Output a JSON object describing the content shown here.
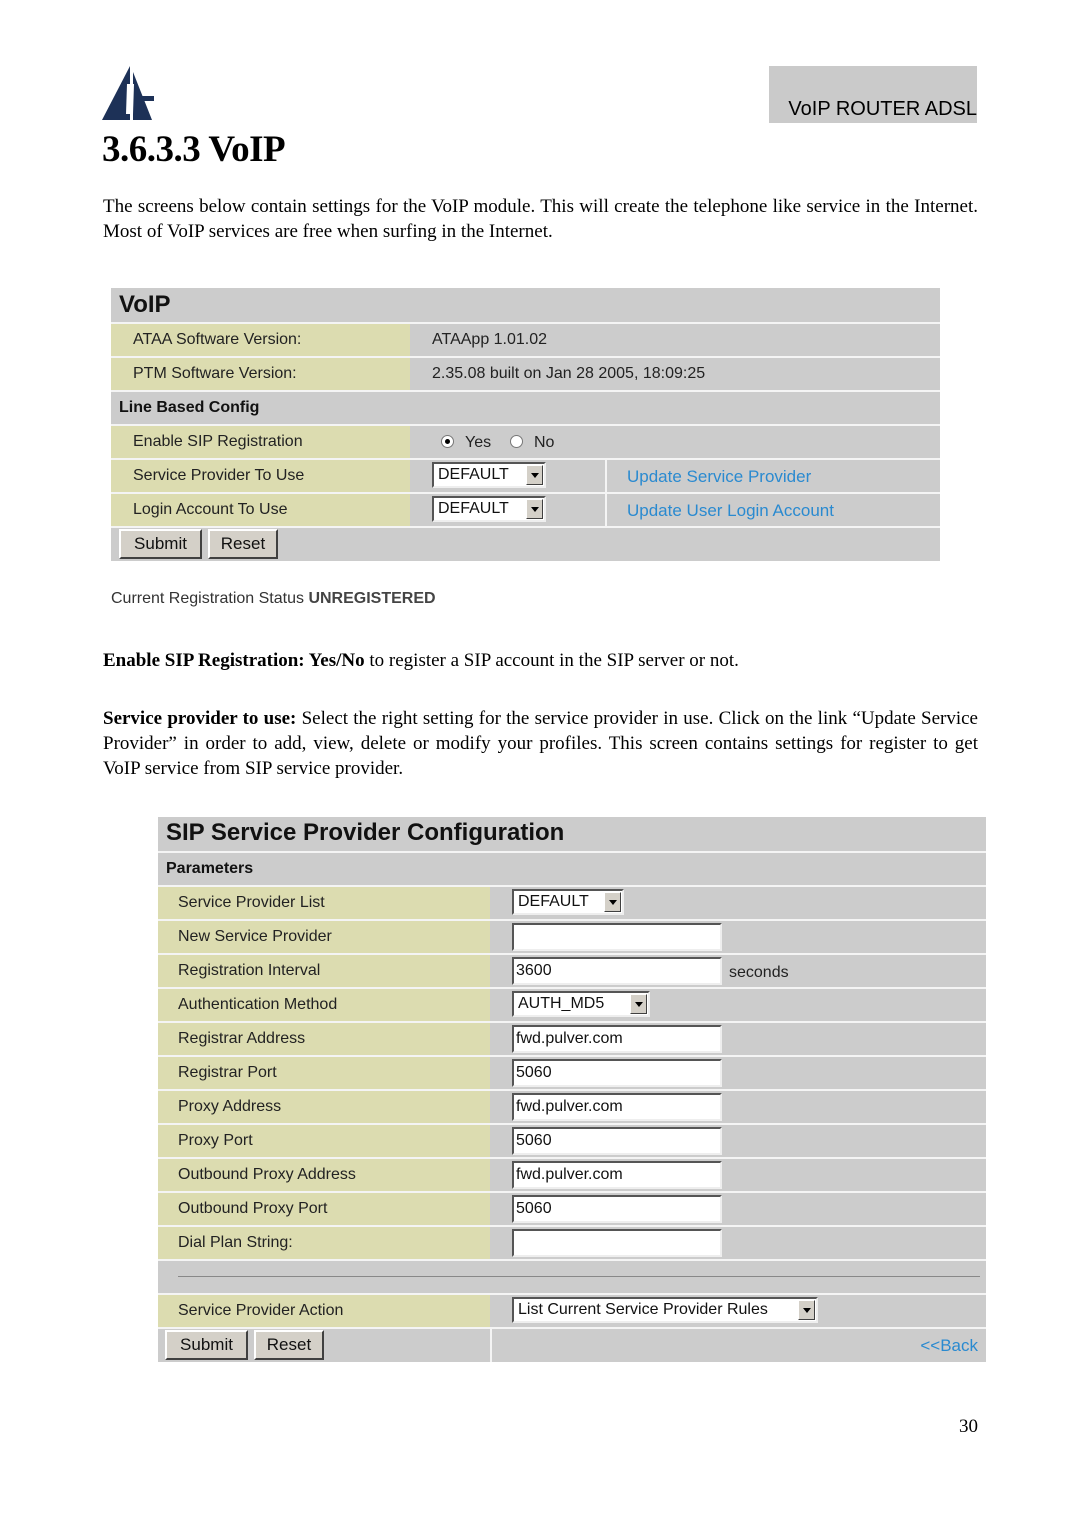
{
  "header": {
    "brand": "VoIP ROUTER ADSL",
    "logo_icon": "atlantis-logo"
  },
  "section_title": "3.6.3.3 VoIP",
  "intro": "The screens below contain settings for the VoIP module. This will create the telephone like service in the Internet. Most of VoIP services are free when surfing in the Internet.",
  "voip_panel": {
    "title": "VoIP",
    "rows": [
      {
        "label": "ATAA Software Version:",
        "value": "ATAApp 1.01.02"
      },
      {
        "label": "PTM Software Version:",
        "value": "2.35.08 built on Jan 28 2005, 18:09:25"
      }
    ],
    "line_config_header": "Line Based Config",
    "enable_sip": {
      "label": "Enable SIP Registration",
      "options": [
        "Yes",
        "No"
      ],
      "selected": "Yes"
    },
    "service_provider": {
      "label": "Service Provider To Use",
      "value": "DEFAULT",
      "link": "Update Service Provider"
    },
    "login_account": {
      "label": "Login Account To Use",
      "value": "DEFAULT",
      "link": "Update User Login Account"
    },
    "submit_label": "Submit",
    "reset_label": "Reset",
    "status_label": "Current Registration Status",
    "status_value": "UNREGISTERED"
  },
  "desc_sip": {
    "bold": "Enable SIP Registration: Yes/No",
    "text": " to register a SIP account in the SIP server or not."
  },
  "desc_provider": {
    "bold": "Service provider to use:",
    "text": " Select the right setting for the service provider in use. Click on the link “Update Service Provider” in order to add, view, delete or modify your profiles. This screen contains settings for register to get VoIP service from SIP service provider."
  },
  "sip_panel": {
    "title": "SIP Service Provider Configuration",
    "params_header": "Parameters",
    "rows": [
      {
        "label": "Service Provider List",
        "type": "select",
        "value": "DEFAULT"
      },
      {
        "label": "New Service Provider",
        "type": "text",
        "value": ""
      },
      {
        "label": "Registration Interval",
        "type": "text",
        "value": "3600",
        "suffix": "seconds"
      },
      {
        "label": "Authentication Method",
        "type": "select",
        "value": "AUTH_MD5"
      },
      {
        "label": "Registrar Address",
        "type": "text",
        "value": "fwd.pulver.com"
      },
      {
        "label": "Registrar Port",
        "type": "text",
        "value": "5060"
      },
      {
        "label": "Proxy Address",
        "type": "text",
        "value": "fwd.pulver.com"
      },
      {
        "label": "Proxy Port",
        "type": "text",
        "value": "5060"
      },
      {
        "label": "Outbound Proxy Address",
        "type": "text",
        "value": "fwd.pulver.com"
      },
      {
        "label": "Outbound Proxy Port",
        "type": "text",
        "value": "5060"
      },
      {
        "label": "Dial Plan String:",
        "type": "text",
        "value": ""
      }
    ],
    "action": {
      "label": "Service Provider Action",
      "value": "List Current Service Provider Rules"
    },
    "submit_label": "Submit",
    "reset_label": "Reset",
    "back_link": "<<Back"
  },
  "page_number": "30"
}
